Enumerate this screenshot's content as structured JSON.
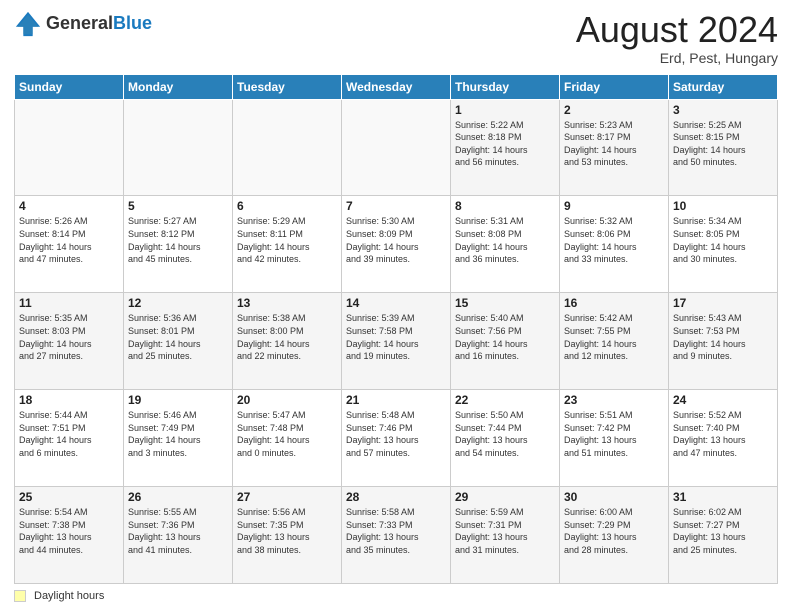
{
  "header": {
    "logo_general": "General",
    "logo_blue": "Blue",
    "month_title": "August 2024",
    "location": "Erd, Pest, Hungary"
  },
  "weekdays": [
    "Sunday",
    "Monday",
    "Tuesday",
    "Wednesday",
    "Thursday",
    "Friday",
    "Saturday"
  ],
  "footer": {
    "daylight_label": "Daylight hours"
  },
  "weeks": [
    [
      {
        "day": "",
        "info": ""
      },
      {
        "day": "",
        "info": ""
      },
      {
        "day": "",
        "info": ""
      },
      {
        "day": "",
        "info": ""
      },
      {
        "day": "1",
        "info": "Sunrise: 5:22 AM\nSunset: 8:18 PM\nDaylight: 14 hours\nand 56 minutes."
      },
      {
        "day": "2",
        "info": "Sunrise: 5:23 AM\nSunset: 8:17 PM\nDaylight: 14 hours\nand 53 minutes."
      },
      {
        "day": "3",
        "info": "Sunrise: 5:25 AM\nSunset: 8:15 PM\nDaylight: 14 hours\nand 50 minutes."
      }
    ],
    [
      {
        "day": "4",
        "info": "Sunrise: 5:26 AM\nSunset: 8:14 PM\nDaylight: 14 hours\nand 47 minutes."
      },
      {
        "day": "5",
        "info": "Sunrise: 5:27 AM\nSunset: 8:12 PM\nDaylight: 14 hours\nand 45 minutes."
      },
      {
        "day": "6",
        "info": "Sunrise: 5:29 AM\nSunset: 8:11 PM\nDaylight: 14 hours\nand 42 minutes."
      },
      {
        "day": "7",
        "info": "Sunrise: 5:30 AM\nSunset: 8:09 PM\nDaylight: 14 hours\nand 39 minutes."
      },
      {
        "day": "8",
        "info": "Sunrise: 5:31 AM\nSunset: 8:08 PM\nDaylight: 14 hours\nand 36 minutes."
      },
      {
        "day": "9",
        "info": "Sunrise: 5:32 AM\nSunset: 8:06 PM\nDaylight: 14 hours\nand 33 minutes."
      },
      {
        "day": "10",
        "info": "Sunrise: 5:34 AM\nSunset: 8:05 PM\nDaylight: 14 hours\nand 30 minutes."
      }
    ],
    [
      {
        "day": "11",
        "info": "Sunrise: 5:35 AM\nSunset: 8:03 PM\nDaylight: 14 hours\nand 27 minutes."
      },
      {
        "day": "12",
        "info": "Sunrise: 5:36 AM\nSunset: 8:01 PM\nDaylight: 14 hours\nand 25 minutes."
      },
      {
        "day": "13",
        "info": "Sunrise: 5:38 AM\nSunset: 8:00 PM\nDaylight: 14 hours\nand 22 minutes."
      },
      {
        "day": "14",
        "info": "Sunrise: 5:39 AM\nSunset: 7:58 PM\nDaylight: 14 hours\nand 19 minutes."
      },
      {
        "day": "15",
        "info": "Sunrise: 5:40 AM\nSunset: 7:56 PM\nDaylight: 14 hours\nand 16 minutes."
      },
      {
        "day": "16",
        "info": "Sunrise: 5:42 AM\nSunset: 7:55 PM\nDaylight: 14 hours\nand 12 minutes."
      },
      {
        "day": "17",
        "info": "Sunrise: 5:43 AM\nSunset: 7:53 PM\nDaylight: 14 hours\nand 9 minutes."
      }
    ],
    [
      {
        "day": "18",
        "info": "Sunrise: 5:44 AM\nSunset: 7:51 PM\nDaylight: 14 hours\nand 6 minutes."
      },
      {
        "day": "19",
        "info": "Sunrise: 5:46 AM\nSunset: 7:49 PM\nDaylight: 14 hours\nand 3 minutes."
      },
      {
        "day": "20",
        "info": "Sunrise: 5:47 AM\nSunset: 7:48 PM\nDaylight: 14 hours\nand 0 minutes."
      },
      {
        "day": "21",
        "info": "Sunrise: 5:48 AM\nSunset: 7:46 PM\nDaylight: 13 hours\nand 57 minutes."
      },
      {
        "day": "22",
        "info": "Sunrise: 5:50 AM\nSunset: 7:44 PM\nDaylight: 13 hours\nand 54 minutes."
      },
      {
        "day": "23",
        "info": "Sunrise: 5:51 AM\nSunset: 7:42 PM\nDaylight: 13 hours\nand 51 minutes."
      },
      {
        "day": "24",
        "info": "Sunrise: 5:52 AM\nSunset: 7:40 PM\nDaylight: 13 hours\nand 47 minutes."
      }
    ],
    [
      {
        "day": "25",
        "info": "Sunrise: 5:54 AM\nSunset: 7:38 PM\nDaylight: 13 hours\nand 44 minutes."
      },
      {
        "day": "26",
        "info": "Sunrise: 5:55 AM\nSunset: 7:36 PM\nDaylight: 13 hours\nand 41 minutes."
      },
      {
        "day": "27",
        "info": "Sunrise: 5:56 AM\nSunset: 7:35 PM\nDaylight: 13 hours\nand 38 minutes."
      },
      {
        "day": "28",
        "info": "Sunrise: 5:58 AM\nSunset: 7:33 PM\nDaylight: 13 hours\nand 35 minutes."
      },
      {
        "day": "29",
        "info": "Sunrise: 5:59 AM\nSunset: 7:31 PM\nDaylight: 13 hours\nand 31 minutes."
      },
      {
        "day": "30",
        "info": "Sunrise: 6:00 AM\nSunset: 7:29 PM\nDaylight: 13 hours\nand 28 minutes."
      },
      {
        "day": "31",
        "info": "Sunrise: 6:02 AM\nSunset: 7:27 PM\nDaylight: 13 hours\nand 25 minutes."
      }
    ]
  ]
}
